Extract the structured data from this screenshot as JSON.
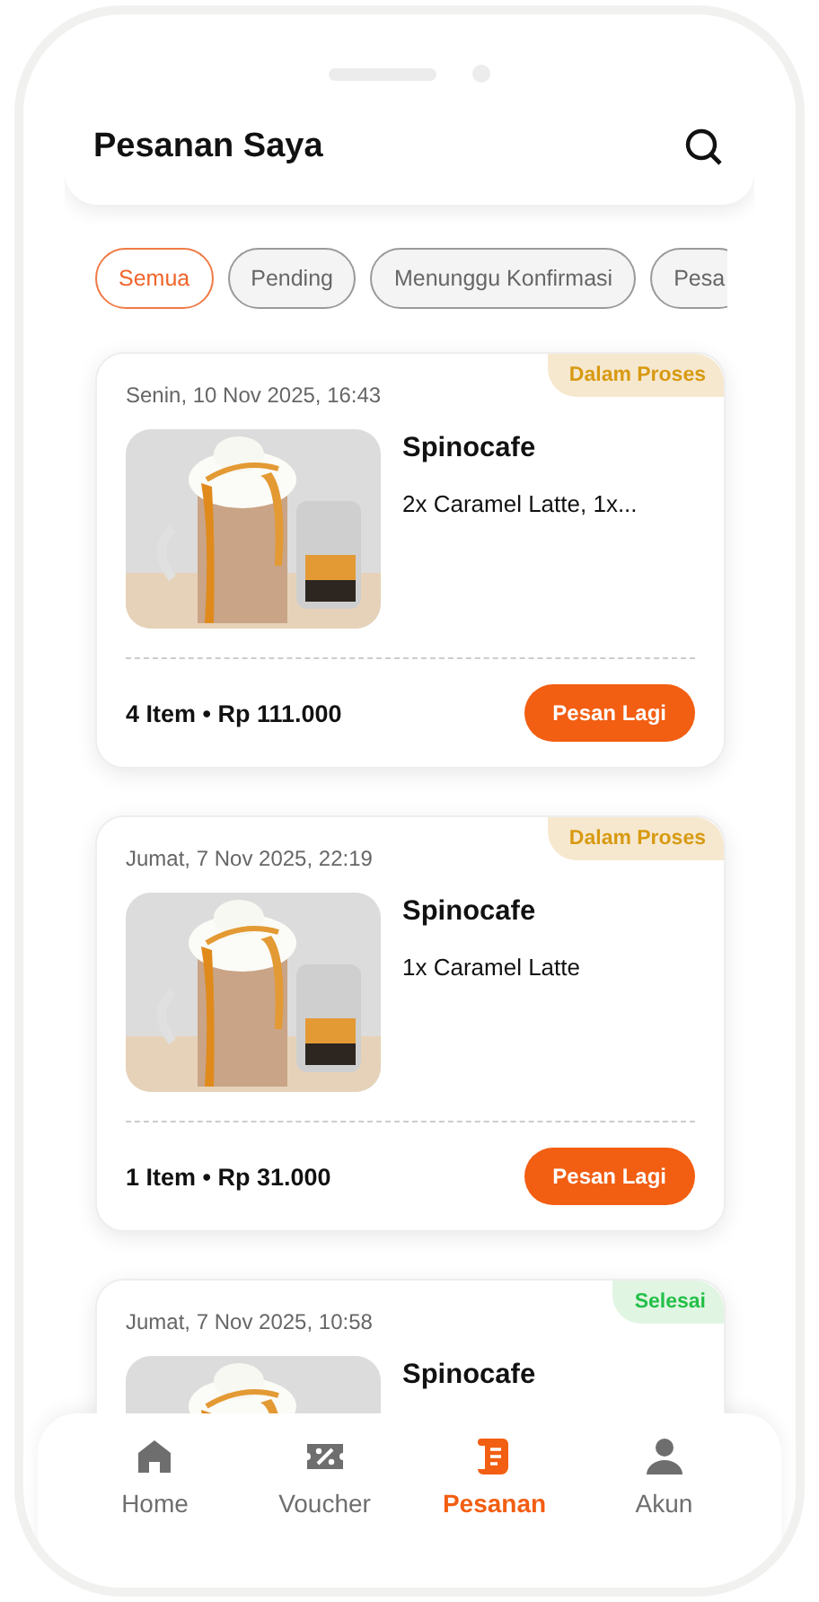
{
  "header": {
    "title": "Pesanan Saya"
  },
  "filters": [
    {
      "label": "Semua",
      "selected": true
    },
    {
      "label": "Pending",
      "selected": false
    },
    {
      "label": "Menunggu Konfirmasi",
      "selected": false
    },
    {
      "label": "Pesa",
      "selected": false
    }
  ],
  "orders": [
    {
      "date": "Senin, 10 Nov 2025, 16:43",
      "status": {
        "label": "Dalam Proses",
        "kind": "process"
      },
      "store": "Spinocafe",
      "items": "2x Caramel Latte, 1x...",
      "summary": "4 Item • Rp 111.000",
      "action": "Pesan Lagi"
    },
    {
      "date": "Jumat, 7 Nov 2025, 22:19",
      "status": {
        "label": "Dalam Proses",
        "kind": "process"
      },
      "store": "Spinocafe",
      "items": "1x Caramel Latte",
      "summary": "1 Item • Rp 31.000",
      "action": "Pesan Lagi"
    },
    {
      "date": "Jumat, 7 Nov 2025, 10:58",
      "status": {
        "label": "Selesai",
        "kind": "done"
      },
      "store": "Spinocafe"
    }
  ],
  "nav": [
    {
      "label": "Home",
      "kind": "home",
      "selected": false
    },
    {
      "label": "Voucher",
      "kind": "voucher",
      "selected": false
    },
    {
      "label": "Pesanan",
      "kind": "orders",
      "selected": true
    },
    {
      "label": "Akun",
      "kind": "account",
      "selected": false
    }
  ]
}
